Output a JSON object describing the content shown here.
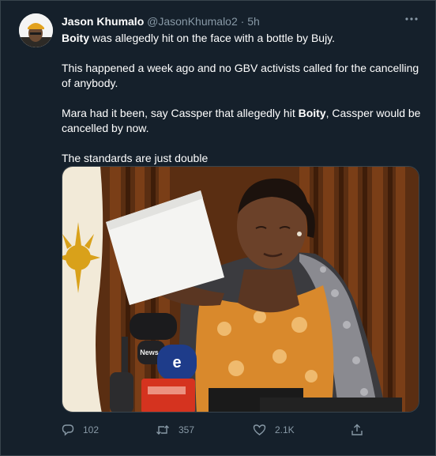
{
  "tweet": {
    "author_name": "Jason Khumalo",
    "handle": "@JasonKhumalo2",
    "separator": "·",
    "time": "5h",
    "more_icon": "more-horizontal-icon",
    "body": {
      "p1_bold": "Boity",
      "p1_rest": " was allegedly hit on the face with a bottle by Bujy.",
      "p2": "This happened a week ago and no GBV activists called for the cancelling of anybody.",
      "p3_start": "Mara had it been, say Cassper that allegedly hit ",
      "p3_bold": "Boity",
      "p3_end": ", Cassper would be cancelled by now.",
      "p4": "The standards are just double"
    },
    "media": {
      "description_icon": "photo-woman-at-press-conference",
      "mic_labels": [
        "e",
        "eNCA",
        "News"
      ]
    },
    "actions": {
      "replies": "102",
      "retweets": "357",
      "likes": "2.1K",
      "reply_icon": "reply-icon",
      "retweet_icon": "retweet-icon",
      "like_icon": "heart-icon",
      "share_icon": "share-icon"
    }
  },
  "colors": {
    "background": "#15202b",
    "muted": "#8899a6",
    "border": "#38444d"
  }
}
